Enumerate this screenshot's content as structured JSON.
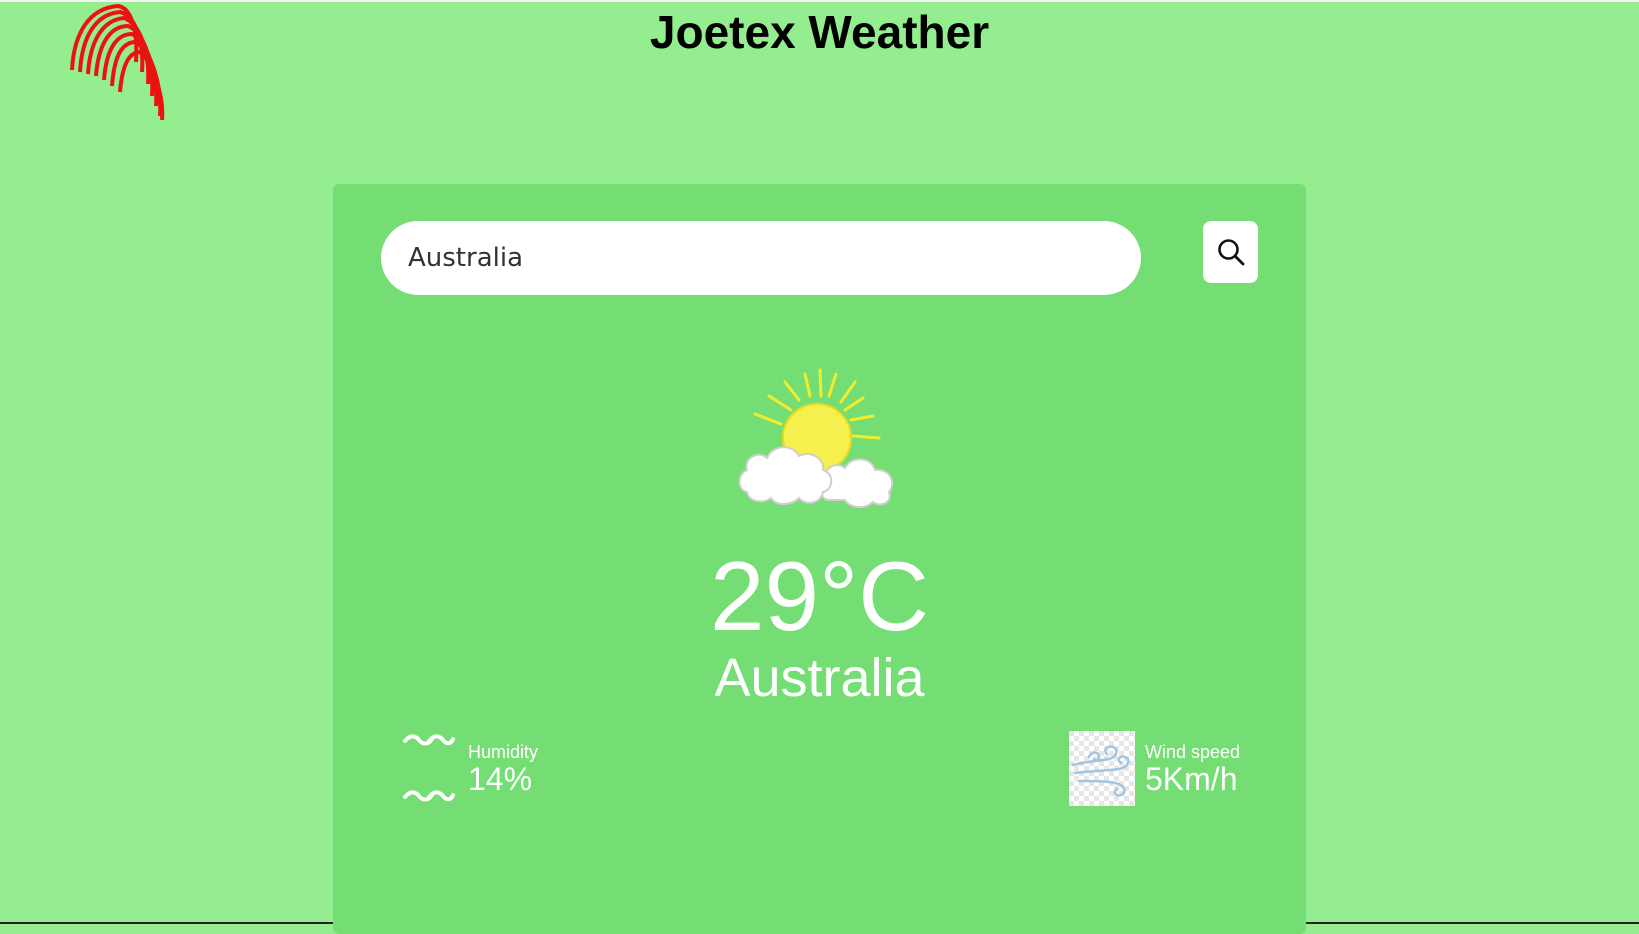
{
  "header": {
    "title": "Joetex Weather",
    "logo_icon": "striped-arc-logo-icon"
  },
  "search": {
    "value": "Australia",
    "button_icon": "search-icon"
  },
  "weather": {
    "condition_icon": "sun-behind-clouds-icon",
    "temperature": "29°C",
    "city": "Australia"
  },
  "stats": {
    "humidity": {
      "icon": "humidity-waves-icon",
      "label": "Humidity",
      "value": "14%"
    },
    "wind": {
      "icon": "wind-icon",
      "label": "Wind speed",
      "value": "5Km/h"
    }
  },
  "colors": {
    "page_background": "#94ee90",
    "card_background": "#74de74",
    "logo_red": "#ee1111"
  }
}
